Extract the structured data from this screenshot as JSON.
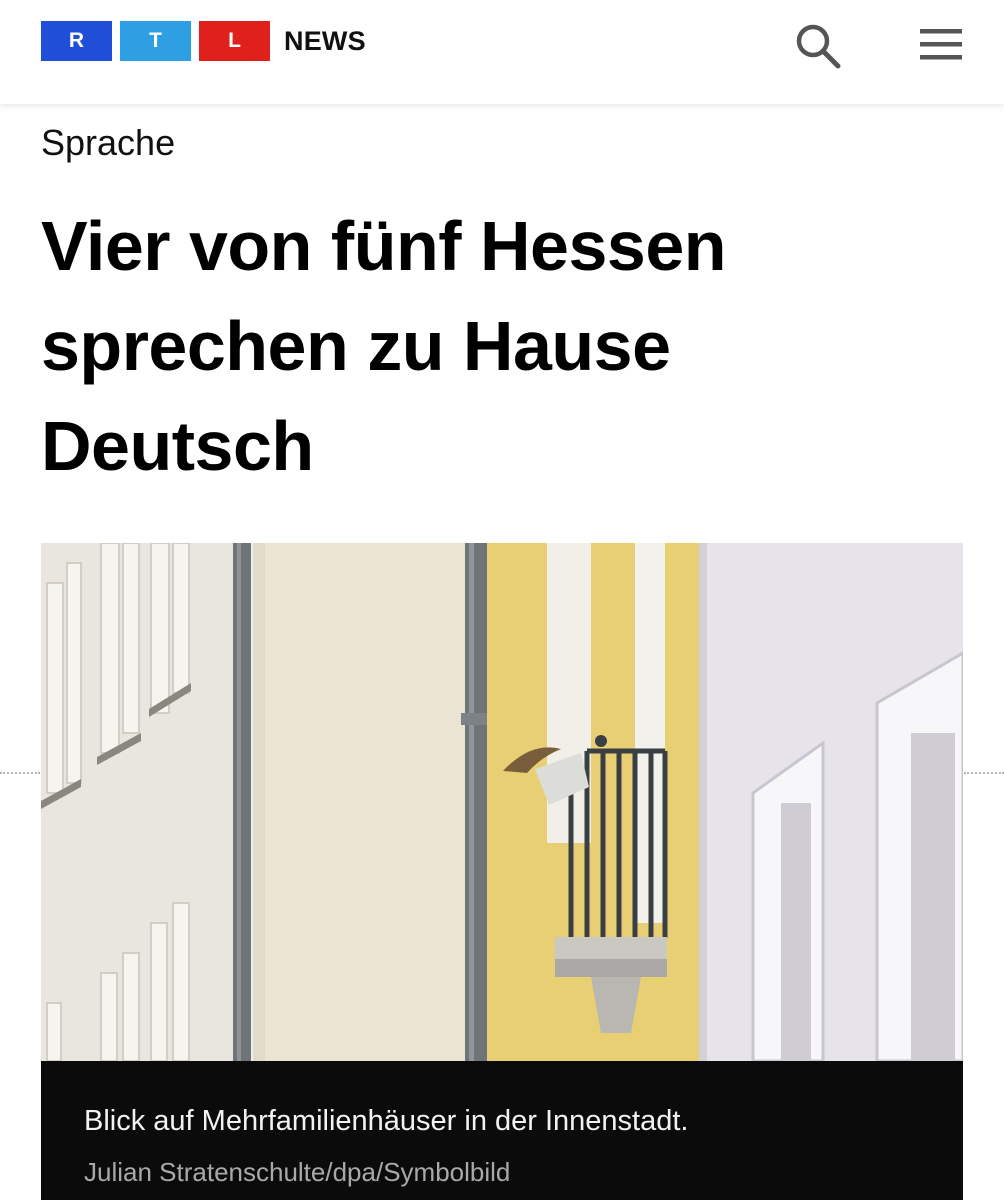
{
  "header": {
    "logo_letters": [
      "R",
      "T",
      "L"
    ],
    "logo_colors": [
      "#1e4fd6",
      "#2e9fe3",
      "#e0201b"
    ],
    "brand_word": "NEWS",
    "search_icon": "search-icon",
    "menu_icon": "hamburger-menu-icon"
  },
  "article": {
    "kicker": "Sprache",
    "headline_lines": [
      "Vier von fünf Hessen",
      "sprechen zu Hause",
      "Deutsch"
    ],
    "image": {
      "caption": "Blick auf Mehrfamilienhäuser in der Innenstadt.",
      "credit": "Julian Stratenschulte/dpa/Symbolbild"
    }
  }
}
